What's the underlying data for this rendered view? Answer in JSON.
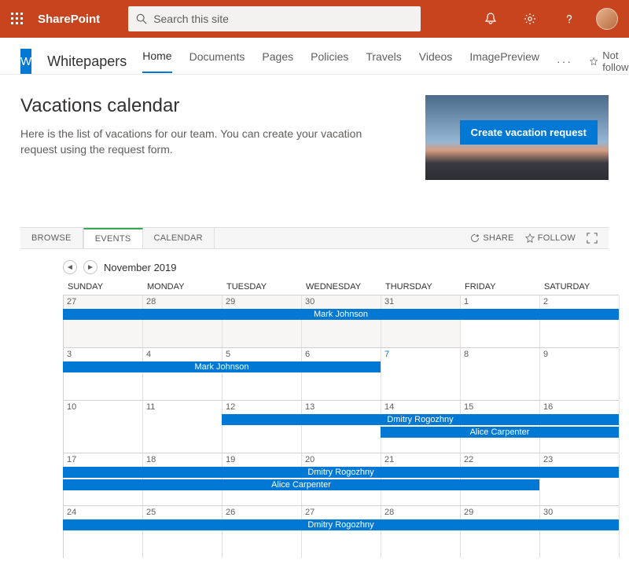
{
  "suite": {
    "product": "SharePoint",
    "search_placeholder": "Search this site"
  },
  "site": {
    "logo_letter": "W",
    "title": "Whitepapers",
    "nav": [
      "Home",
      "Documents",
      "Pages",
      "Policies",
      "Travels",
      "Videos",
      "ImagePreview"
    ],
    "not_following": "Not following"
  },
  "page": {
    "heading": "Vacations calendar",
    "description": "Here is the list of vacations for our team. You can create your vacation request using the request form.",
    "cta": "Create vacation request"
  },
  "ribbon": {
    "tabs": [
      "BROWSE",
      "EVENTS",
      "CALENDAR"
    ],
    "share": "SHARE",
    "follow": "FOLLOW"
  },
  "calendar": {
    "month_label": "November 2019",
    "day_headers": [
      "SUNDAY",
      "MONDAY",
      "TUESDAY",
      "WEDNESDAY",
      "THURSDAY",
      "FRIDAY",
      "SATURDAY"
    ],
    "weeks": [
      {
        "days": [
          {
            "n": "27",
            "prev": true
          },
          {
            "n": "28",
            "prev": true
          },
          {
            "n": "29",
            "prev": true
          },
          {
            "n": "30",
            "prev": true
          },
          {
            "n": "31",
            "prev": true
          },
          {
            "n": "1"
          },
          {
            "n": "2"
          }
        ],
        "bars": [
          {
            "label": "Mark Johnson",
            "startCol": 0,
            "endCol": 7,
            "row": 0
          }
        ]
      },
      {
        "days": [
          {
            "n": "3"
          },
          {
            "n": "4"
          },
          {
            "n": "5"
          },
          {
            "n": "6"
          },
          {
            "n": "7",
            "today": true
          },
          {
            "n": "8"
          },
          {
            "n": "9"
          }
        ],
        "bars": [
          {
            "label": "Mark Johnson",
            "startCol": 0,
            "endCol": 4,
            "row": 0
          }
        ]
      },
      {
        "days": [
          {
            "n": "10"
          },
          {
            "n": "11"
          },
          {
            "n": "12"
          },
          {
            "n": "13"
          },
          {
            "n": "14"
          },
          {
            "n": "15"
          },
          {
            "n": "16"
          }
        ],
        "bars": [
          {
            "label": "Dmitry Rogozhny",
            "startCol": 2,
            "endCol": 7,
            "row": 0
          },
          {
            "label": "Alice Carpenter",
            "startCol": 4,
            "endCol": 7,
            "row": 1
          }
        ]
      },
      {
        "days": [
          {
            "n": "17"
          },
          {
            "n": "18"
          },
          {
            "n": "19"
          },
          {
            "n": "20"
          },
          {
            "n": "21"
          },
          {
            "n": "22"
          },
          {
            "n": "23"
          }
        ],
        "bars": [
          {
            "label": "Dmitry Rogozhny",
            "startCol": 0,
            "endCol": 7,
            "row": 0
          },
          {
            "label": "Alice Carpenter",
            "startCol": 0,
            "endCol": 6,
            "row": 1
          }
        ]
      },
      {
        "days": [
          {
            "n": "24"
          },
          {
            "n": "25"
          },
          {
            "n": "26"
          },
          {
            "n": "27"
          },
          {
            "n": "28"
          },
          {
            "n": "29"
          },
          {
            "n": "30"
          }
        ],
        "bars": [
          {
            "label": "Dmitry Rogozhny",
            "startCol": 0,
            "endCol": 7,
            "row": 0
          }
        ]
      }
    ]
  }
}
